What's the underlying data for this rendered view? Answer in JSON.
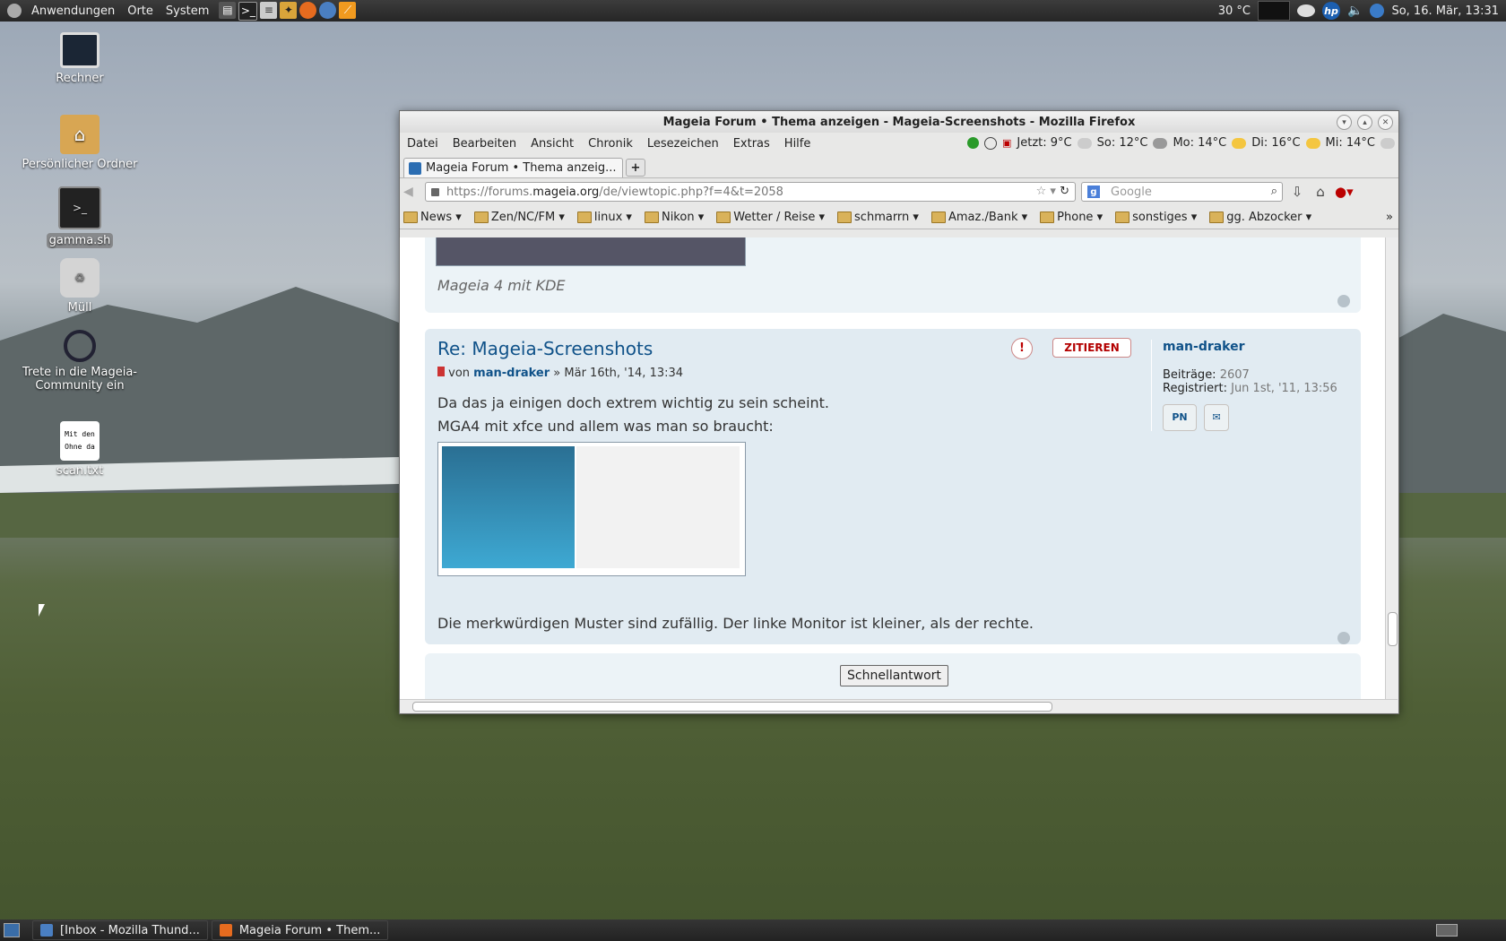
{
  "top_panel": {
    "menus": [
      "Anwendungen",
      "Orte",
      "System"
    ],
    "quicklaunch_icons": [
      "terminal-icon",
      "monitor-icon",
      "editor-icon",
      "image-icon",
      "firefox-icon",
      "thunderbird-icon",
      "app-icon"
    ],
    "temperature": "30 °C",
    "datetime": "So, 16. Mär, 13:31"
  },
  "desktop_icons": [
    {
      "label": "Rechner",
      "icon": "computer-icon"
    },
    {
      "label": "Persönlicher Ordner",
      "icon": "home-folder-icon"
    },
    {
      "label": "gamma.sh",
      "icon": "script-icon"
    },
    {
      "label": "Müll",
      "icon": "trash-icon"
    },
    {
      "label": "Trete in die Mageia-Community ein",
      "icon": "mageia-icon"
    },
    {
      "label": "scan.txt",
      "icon": "text-file-icon",
      "preview": "Mit den Ohne da"
    }
  ],
  "firefox": {
    "window_title": "Mageia Forum • Thema anzeigen - Mageia-Screenshots - Mozilla Firefox",
    "menu": [
      "Datei",
      "Bearbeiten",
      "Ansicht",
      "Chronik",
      "Lesezeichen",
      "Extras",
      "Hilfe"
    ],
    "weather": [
      {
        "text": "Jetzt: 9°C",
        "icon": "cloud-icon"
      },
      {
        "text": "So: 12°C",
        "icon": "rain-cloud-icon"
      },
      {
        "text": "Mo: 14°C",
        "icon": "sun-cloud-icon"
      },
      {
        "text": "Di: 16°C",
        "icon": "sun-cloud-icon"
      },
      {
        "text": "Mi: 14°C",
        "icon": "cloud-icon"
      }
    ],
    "tab_title": "Mageia Forum • Thema anzeig...",
    "newtab_label": "+",
    "url_prefix": "https://forums.",
    "url_host": "mageia.org",
    "url_path": "/de/viewtopic.php?f=4&t=2058",
    "search_placeholder": "Google",
    "bookmarks": [
      "News",
      "Zen/NC/FM",
      "linux",
      "Nikon",
      "Wetter / Reise",
      "schmarrn",
      "Amaz./Bank",
      "Phone",
      "sonstiges",
      "gg. Abzocker"
    ],
    "bookmarks_overflow": "»"
  },
  "forum": {
    "prev_caption": "Mageia 4 mit KDE",
    "post": {
      "title": "Re: Mageia-Screenshots",
      "meta_prefix": "von",
      "author": "man-draker",
      "meta_date": "» Mär 16th, '14, 13:34",
      "quote_label": "ZITIEREN",
      "report_label": "!",
      "body_line1": "Da das ja einigen doch extrem wichtig zu sein scheint.",
      "body_line2": "MGA4 mit xfce und allem was man so braucht:",
      "body_line3": "Die merkwürdigen Muster sind zufällig. Der linke Monitor ist kleiner, als der rechte."
    },
    "profile": {
      "username": "man-draker",
      "posts_label": "Beiträge:",
      "posts_value": "2607",
      "registered_label": "Registriert:",
      "registered_value": "Jun 1st, '11, 13:56",
      "pm_label": "PN"
    },
    "quick_reply": "Schnellantwort"
  },
  "taskbar": [
    {
      "label": "[Inbox - Mozilla Thund...",
      "icon": "thunderbird-icon"
    },
    {
      "label": "Mageia Forum • Them...",
      "icon": "firefox-icon"
    }
  ]
}
